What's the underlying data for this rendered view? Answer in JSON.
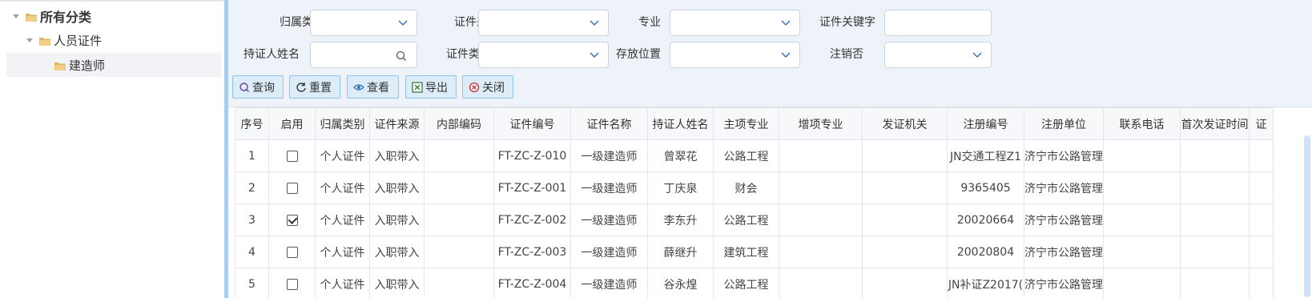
{
  "tree": {
    "root": "所有分类",
    "child": "人员证件",
    "leaf": "建造师"
  },
  "filters": {
    "row1": [
      {
        "label": "归属类别",
        "value": ""
      },
      {
        "label": "证件来源",
        "value": ""
      },
      {
        "label": "专业",
        "value": ""
      },
      {
        "label": "证件关键字",
        "value": ""
      }
    ],
    "row2": [
      {
        "label": "持证人姓名",
        "value": ""
      },
      {
        "label": "证件类别",
        "value": ""
      },
      {
        "label": "存放位置",
        "value": ""
      },
      {
        "label": "注销否",
        "value": ""
      }
    ]
  },
  "toolbar": {
    "query": "查询",
    "reset": "重置",
    "view": "查看",
    "export": "导出",
    "close": "关闭"
  },
  "table": {
    "headers": [
      "序号",
      "启用",
      "归属类别",
      "证件来源",
      "内部编码",
      "证件编号",
      "证件名称",
      "持证人姓名",
      "主项专业",
      "增项专业",
      "发证机关",
      "注册编号",
      "注册单位",
      "联系电话",
      "首次发证时间",
      "证"
    ],
    "rows": [
      {
        "no": "1",
        "enabled": false,
        "category": "个人证件",
        "source": "入职带入",
        "internal": "",
        "cert_no": "FT-ZC-Z-010",
        "cert_name": "一级建造师",
        "holder": "曾翠花",
        "major": "公路工程",
        "extra": "",
        "issuer": "",
        "reg_no": "JN交通工程Z1",
        "reg_unit": "济宁市公路管理",
        "phone": "",
        "first_date": ""
      },
      {
        "no": "2",
        "enabled": false,
        "category": "个人证件",
        "source": "入职带入",
        "internal": "",
        "cert_no": "FT-ZC-Z-001",
        "cert_name": "一级建造师",
        "holder": "丁庆泉",
        "major": "财会",
        "extra": "",
        "issuer": "",
        "reg_no": "9365405",
        "reg_unit": "济宁市公路管理",
        "phone": "",
        "first_date": ""
      },
      {
        "no": "3",
        "enabled": true,
        "category": "个人证件",
        "source": "入职带入",
        "internal": "",
        "cert_no": "FT-ZC-Z-002",
        "cert_name": "一级建造师",
        "holder": "李东升",
        "major": "公路工程",
        "extra": "",
        "issuer": "",
        "reg_no": "20020664",
        "reg_unit": "济宁市公路管理",
        "phone": "",
        "first_date": ""
      },
      {
        "no": "4",
        "enabled": false,
        "category": "个人证件",
        "source": "入职带入",
        "internal": "",
        "cert_no": "FT-ZC-Z-003",
        "cert_name": "一级建造师",
        "holder": "薛继升",
        "major": "建筑工程",
        "extra": "",
        "issuer": "",
        "reg_no": "20020804",
        "reg_unit": "济宁市公路管理",
        "phone": "",
        "first_date": ""
      },
      {
        "no": "5",
        "enabled": false,
        "category": "个人证件",
        "source": "入职带入",
        "internal": "",
        "cert_no": "FT-ZC-Z-004",
        "cert_name": "一级建造师",
        "holder": "谷永煌",
        "major": "公路工程",
        "extra": "",
        "issuer": "",
        "reg_no": "JN补证Z2017(",
        "reg_unit": "济宁市公路管理",
        "phone": "",
        "first_date": ""
      }
    ]
  },
  "colors": {
    "accent": "#a9cdea",
    "button_bg": "#dcecf9",
    "button_border": "#8fc3e8",
    "folder": "#e0b460"
  }
}
